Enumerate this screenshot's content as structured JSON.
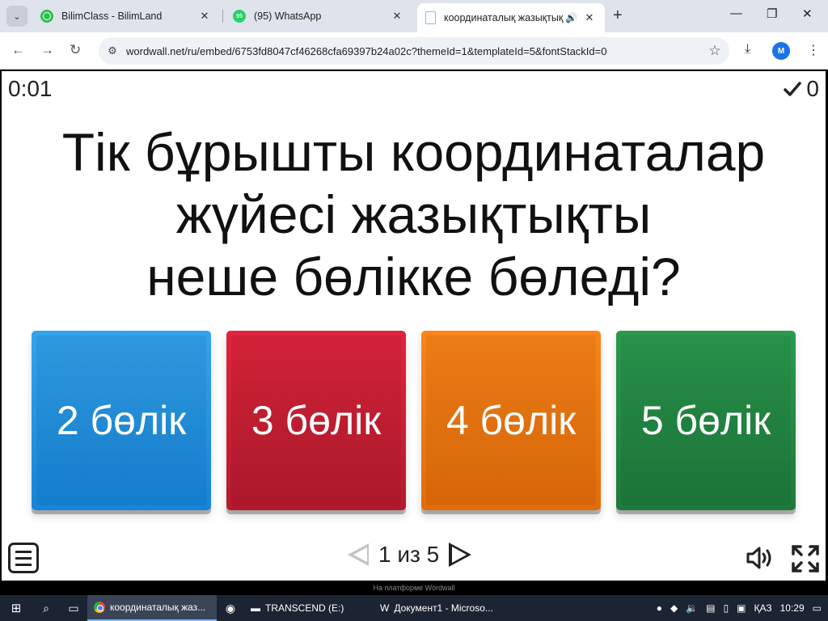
{
  "browser": {
    "tabs": [
      {
        "title": "BilimClass - BilimLand",
        "close": "✕"
      },
      {
        "title": "(95) WhatsApp",
        "badge": "95",
        "close": "✕"
      },
      {
        "title": "координаталық жазықтық",
        "close": "✕",
        "active": true
      }
    ],
    "new_tab": "+",
    "window": {
      "minimize": "—",
      "maximize": "❐",
      "close": "✕"
    },
    "url": "wordwall.net/ru/embed/6753fd8047cf46268cfa69397b24a02c?themeId=1&templateId=5&fontStackId=0",
    "profile_initial": "M"
  },
  "game": {
    "timer": "0:01",
    "score": "0",
    "question": {
      "line1": "Тік бұрышты координаталар",
      "line2": "жүйесі жазықтықты",
      "line3": "неше бөлікке бөледі?"
    },
    "answers": [
      "2 бөлік",
      "3 бөлік",
      "4 бөлік",
      "5 бөлік"
    ],
    "answer_colors": [
      "#1f90e2",
      "#cf1f35",
      "#f27810",
      "#238a45"
    ],
    "pager": {
      "current": "1",
      "of": "из",
      "total": "5"
    },
    "powered_by": "На платформе Wordwall"
  },
  "taskbar": {
    "apps": [
      {
        "label": "координаталық жаз...",
        "active": true
      },
      {
        "label": "TRANSCEND (E:)"
      },
      {
        "label": "Документ1 - Microso..."
      }
    ],
    "language": "ҚАЗ",
    "time": "10:29"
  },
  "icons": [
    "search-icon",
    "task-view-icon",
    "whatsapp-icon",
    "folder-icon",
    "word-icon",
    "speaker-icon",
    "network-icon",
    "notification-icon"
  ]
}
